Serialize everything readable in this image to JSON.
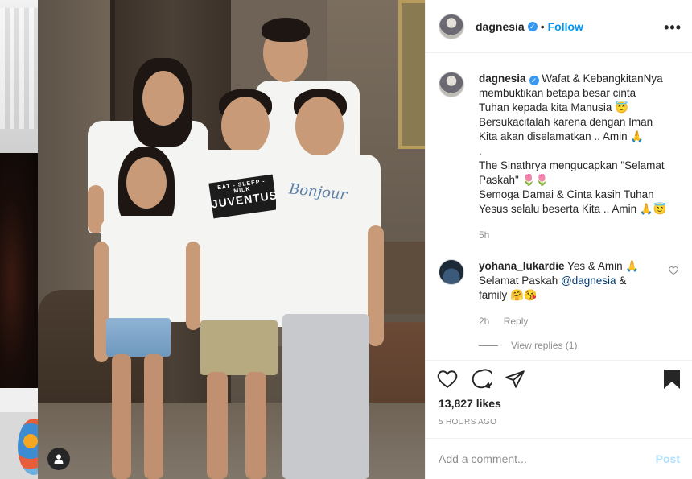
{
  "post": {
    "username": "dagnesia",
    "verified_icon": "verified-badge-icon",
    "dot": "•",
    "follow_label": "Follow",
    "more_label": "•••",
    "image_alt": "Family photo"
  },
  "caption": {
    "username": "dagnesia",
    "lines": [
      "Wafat & KebangkitanNya",
      "membuktikan betapa besar cinta",
      "Tuhan kepada kita Manusia 😇",
      "Bersukacitalah karena dengan Iman",
      "Kita akan diselamatkan .. Amin 🙏",
      ".",
      "The Sinathrya mengucapkan \"Selamat",
      "Paskah\" 🌷🌷",
      "Semoga Damai & Cinta kasih Tuhan",
      "Yesus selalu beserta Kita .. Amin 🙏😇"
    ],
    "time": "5h"
  },
  "comment": {
    "username": "yohana_lukardie",
    "text_before": "Yes & Amin 🙏 Selamat Paskah ",
    "mention": "@dagnesia",
    "text_after": " & family 🤗😘",
    "time": "2h",
    "reply_label": "Reply",
    "view_replies": "View replies (1)"
  },
  "stats": {
    "likes": "13,827 likes",
    "time_ago": "5 HOURS AGO"
  },
  "composer": {
    "placeholder": "Add a comment...",
    "post_label": "Post"
  },
  "shirt": {
    "print_small": "EAT - SLEEP - MILK",
    "print_big": "JUVENTUS",
    "bonjour": "Bonjour"
  },
  "colors": {
    "accent": "#0095f6",
    "post_disabled": "#b2dffc",
    "verified": "#3897f0"
  }
}
